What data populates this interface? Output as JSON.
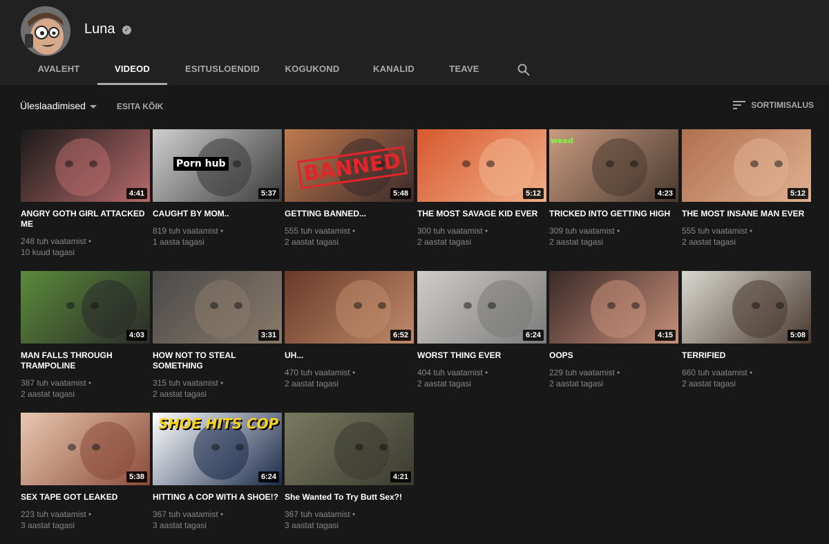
{
  "channel": {
    "name": "Luna"
  },
  "tabs": [
    {
      "label": "AVALEHT",
      "active": false
    },
    {
      "label": "VIDEOD",
      "active": true
    },
    {
      "label": "ESITUSLOENDID",
      "active": false
    },
    {
      "label": "KOGUKOND",
      "active": false
    },
    {
      "label": "KANALID",
      "active": false
    },
    {
      "label": "TEAVE",
      "active": false
    }
  ],
  "subbar": {
    "sort_selected": "Üleslaadimised",
    "play_all": "ESITA KÕIK",
    "sort_by": "SORTIMISALUS"
  },
  "videos": [
    {
      "title": "ANGRY GOTH GIRL ATTACKED ME",
      "duration": "4:41",
      "views": "248 tuh vaatamist •",
      "age": "10 kuud tagasi",
      "thumb_colors": [
        "#1a1a1a",
        "#b86a6a"
      ]
    },
    {
      "title": "CAUGHT BY MOM..",
      "duration": "5:37",
      "views": "819 tuh vaatamist •",
      "age": "1 aasta tagasi",
      "thumb_colors": [
        "#cfcfcf",
        "#3a3a3a"
      ],
      "thumb_text": "Porn hub"
    },
    {
      "title": "GETTING BANNED...",
      "duration": "5:48",
      "views": "555 tuh vaatamist •",
      "age": "2 aastat tagasi",
      "thumb_colors": [
        "#c07a4e",
        "#3a2a2a"
      ],
      "thumb_text": "BANNED"
    },
    {
      "title": "THE MOST SAVAGE KID EVER",
      "duration": "5:12",
      "views": "300 tuh vaatamist •",
      "age": "2 aastat tagasi",
      "thumb_colors": [
        "#d8582e",
        "#f0b08a"
      ]
    },
    {
      "title": "TRICKED INTO GETTING HIGH",
      "duration": "4:23",
      "views": "309 tuh vaatamist •",
      "age": "2 aastat tagasi",
      "thumb_colors": [
        "#c89a80",
        "#4a3a30"
      ],
      "thumb_text": "weed"
    },
    {
      "title": "THE MOST INSANE MAN EVER",
      "duration": "5:12",
      "views": "555 tuh vaatamist •",
      "age": "2 aastat tagasi",
      "thumb_colors": [
        "#b07050",
        "#e0b090"
      ]
    },
    {
      "title": "MAN FALLS THROUGH TRAMPOLINE",
      "duration": "4:03",
      "views": "387 tuh vaatamist •",
      "age": "2 aastat tagasi",
      "thumb_colors": [
        "#5a8a3a",
        "#2a2a2a"
      ]
    },
    {
      "title": "HOW NOT TO STEAL SOMETHING",
      "duration": "3:31",
      "views": "315 tuh vaatamist •",
      "age": "2 aastat tagasi",
      "thumb_colors": [
        "#4a4a4a",
        "#8a7a6a"
      ]
    },
    {
      "title": "UH...",
      "duration": "6:52",
      "views": "470 tuh vaatamist •",
      "age": "2 aastat tagasi",
      "thumb_colors": [
        "#6a3a2a",
        "#c08a6a"
      ]
    },
    {
      "title": "WORST THING EVER",
      "duration": "6:24",
      "views": "404 tuh vaatamist •",
      "age": "2 aastat tagasi",
      "thumb_colors": [
        "#d0ccc8",
        "#7a7a7a"
      ]
    },
    {
      "title": "OOPS",
      "duration": "4:15",
      "views": "229 tuh vaatamist •",
      "age": "2 aastat tagasi",
      "thumb_colors": [
        "#3a2a28",
        "#c8907a"
      ]
    },
    {
      "title": "TERRIFIED",
      "duration": "5:08",
      "views": "660 tuh vaatamist •",
      "age": "2 aastat tagasi",
      "thumb_colors": [
        "#d8d8d0",
        "#4a3a30"
      ]
    },
    {
      "title": "SEX TAPE GOT LEAKED",
      "duration": "5:38",
      "views": "223 tuh vaatamist •",
      "age": "3 aastat tagasi",
      "thumb_colors": [
        "#e8c8b0",
        "#8a4a3a"
      ]
    },
    {
      "title": "HITTING A COP WITH A SHOE!?",
      "duration": "6:24",
      "views": "367 tuh vaatamist •",
      "age": "3 aastat tagasi",
      "thumb_colors": [
        "#ffffff",
        "#1a2a4a"
      ],
      "thumb_text": "SHOE HITS COP"
    },
    {
      "title": "She Wanted To Try Butt Sex?!",
      "duration": "4:21",
      "views": "367 tuh vaatamist •",
      "age": "3 aastat tagasi",
      "thumb_colors": [
        "#7a7a60",
        "#3a3a30"
      ]
    }
  ],
  "icons": {
    "verified": "verified-check-icon",
    "search": "search-icon",
    "sort": "sort-icon",
    "caret": "caret-down-icon"
  }
}
